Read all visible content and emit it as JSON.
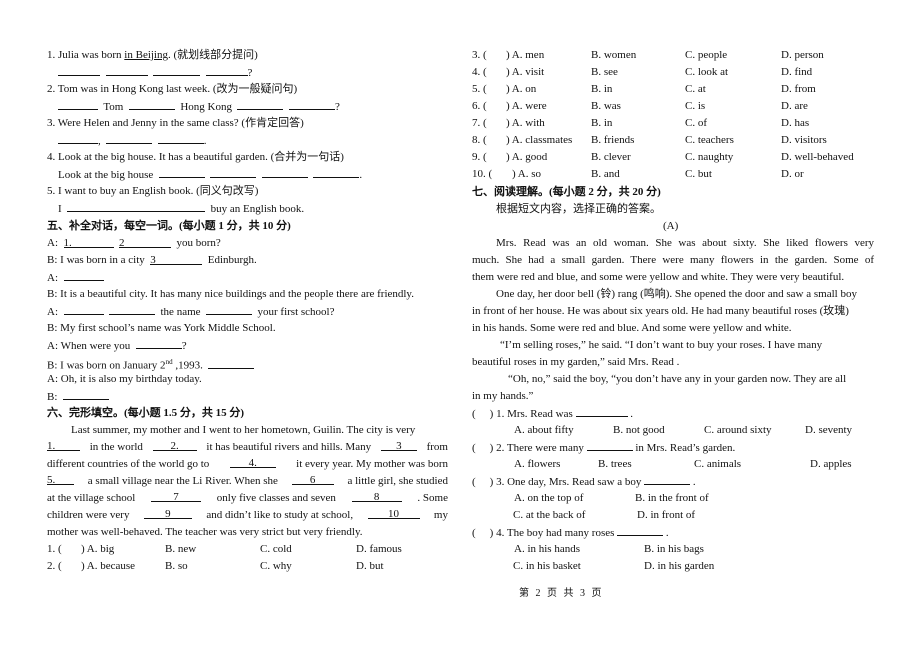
{
  "left": {
    "rewrite": [
      {
        "num": "1.",
        "pre": " Julia was born ",
        "underlined": "in Beijing",
        "post": ". (就划线部分提问)",
        "answer_tail": "?"
      },
      {
        "num": "2.",
        "text": " Tom was in Hong Kong last week. (改为一般疑问句)",
        "answer_words": [
          "Tom",
          "Hong Kong"
        ],
        "answer_tail": "?"
      },
      {
        "num": "3.",
        "text": " Were Helen and Jenny in the same class? (作肯定回答)"
      },
      {
        "num": "4.",
        "text": " Look at the big house. It has a beautiful garden. (合并为一句话)",
        "answer_prefix": "Look at the big house"
      },
      {
        "num": "5.",
        "text": " I want to buy an English book. (同义句改写)",
        "answer_prefix": "I",
        "answer_suffix": "buy an English book."
      }
    ],
    "section5": {
      "title": "五、补全对话，每空一词。(每小题 1 分，共 10 分)",
      "lines": [
        {
          "speaker": "A:",
          "b1": "1.",
          "b2": "2",
          "tail": "you born?"
        },
        {
          "speaker": "B:",
          "pre": "I was born in a city",
          "b3": "3",
          "tail": "Edinburgh."
        },
        {
          "speaker": "A:"
        },
        {
          "speaker": "B:",
          "text": "It is a beautiful city. It has many nice buildings and the people there are friendly."
        },
        {
          "speaker": "A:",
          "mid": "the name",
          "tail": "your first school?"
        },
        {
          "speaker": "B:",
          "text": "My first school’s name was York Middle School."
        },
        {
          "speaker": "A:",
          "pre": "When were you",
          "tail": "?"
        },
        {
          "speaker": "B:",
          "pre": "I was born on January 2",
          "sup": "nd",
          "post": " ,1993."
        },
        {
          "speaker": "A:",
          "text": "Oh, it is also my birthday today."
        },
        {
          "speaker": "B:"
        }
      ]
    },
    "section6": {
      "title": "六、完形填空。(每小题 1.5 分，共 15 分)",
      "para": [
        {
          "t": "Last summer, my mother and I went to her hometown, Guilin. The city is very"
        },
        {
          "b1": "1.",
          "t1": "in the world",
          "b2": "2.",
          "t2": "it has beautiful rivers and hills. Many",
          "b3": "3",
          "t3": "from"
        },
        {
          "t1": "different countries of the world go to",
          "b4": "4.",
          "t2": "it every year. My mother was born"
        },
        {
          "b5": "5.",
          "t1": "a small village near the Li River. When she",
          "b6": "6",
          "t2": "a little girl, she studied"
        },
        {
          "t1": "at the village school",
          "b7": "7",
          "t2": "only five classes and seven",
          "b8": "8",
          "t3": ". Some"
        },
        {
          "t1": "children were very",
          "b9": "9",
          "t2": "and didn’t like to study at school,",
          "b10": "10",
          "t3": "my"
        },
        {
          "t": "mother was well-behaved. The teacher was very strict but very friendly."
        }
      ],
      "questions": [
        {
          "num": "1. (",
          "A": ") A. big",
          "B": "B. new",
          "C": "C. cold",
          "D": "D. famous"
        },
        {
          "num": "2. (",
          "A": ") A. because",
          "B": "B. so",
          "C": "C. why",
          "D": "D. but"
        }
      ]
    }
  },
  "right": {
    "questions": [
      {
        "num": "3. (",
        "A": ") A. men",
        "B": "B. women",
        "C": "C. people",
        "D": "D. person"
      },
      {
        "num": "4. (",
        "A": ") A. visit",
        "B": "B. see",
        "C": "C. look at",
        "D": "D. find"
      },
      {
        "num": "5. (",
        "A": ") A. on",
        "B": "B. in",
        "C": "C. at",
        "D": "D. from"
      },
      {
        "num": "6. (",
        "A": ") A. were",
        "B": "B. was",
        "C": "C. is",
        "D": "D. are"
      },
      {
        "num": "7. (",
        "A": ") A. with",
        "B": "B. in",
        "C": "C. of",
        "D": "D. has"
      },
      {
        "num": "8. (",
        "A": ") A. classmates",
        "B": "B. friends",
        "C": "C. teachers",
        "D": "D. visitors"
      },
      {
        "num": "9. (",
        "A": ") A. good",
        "B": "B. clever",
        "C": "C. naughty",
        "D": "D. well-behaved"
      },
      {
        "num": "10. (",
        "A": ") A. so",
        "B": "B. and",
        "C": "C. but",
        "D": "D. or"
      }
    ],
    "section7": {
      "title": "七、阅读理解。(每小题 2 分，共 20 分)",
      "instruction": "根据短文内容，选择正确的答案。",
      "passage_label": "(A)",
      "lines": [
        "Mrs. Read was an old woman. She was about sixty. She liked flowers very",
        "much. She had a small garden. There were many flowers in the garden. Some of",
        "them were red and blue, and some were yellow and white. They were very beautiful.",
        "One day, her door bell (铃) rang (鸣响). She opened the door and saw a small boy",
        "in front of her house. He was about six years old. He had many beautiful roses (玫瑰)",
        "in his hands. Some were red and blue. And some were yellow and white.",
        "“I’m selling roses,” he said.  “I don’t want to buy your roses. I have many",
        "beautiful roses in my garden,” said Mrs. Read .",
        "“Oh, no,” said the boy,  “you don’t have any in your garden now. They are all",
        "in my hands.”"
      ],
      "questions": [
        {
          "paren": "(",
          "stem_pre": ") 1. Mrs. Read was",
          "stem_post": ".",
          "A": "A. about fifty",
          "B": "B. not good",
          "C": "C. around sixty",
          "D": "D. seventy"
        },
        {
          "paren": "(",
          "stem_pre": ") 2. There were many",
          "stem_post": "in Mrs. Read’s garden.",
          "A": "A. flowers",
          "B": "B. trees",
          "C": "C. animals",
          "D": "D. apples"
        },
        {
          "paren": "(",
          "stem_pre": ") 3. One day, Mrs. Read saw a boy",
          "stem_post": ".",
          "A": "A. on the top of",
          "B": "B. in the front of",
          "C": "C. at the back of",
          "D": "D. in front of"
        },
        {
          "paren": "(",
          "stem_pre": ") 4. The boy had many roses",
          "stem_post": ".",
          "A": "A. in his hands",
          "B": "B. in his bags",
          "C": "C. in his basket",
          "D": "D. in his garden"
        }
      ]
    }
  },
  "footer": "第 2 页 共 3 页"
}
